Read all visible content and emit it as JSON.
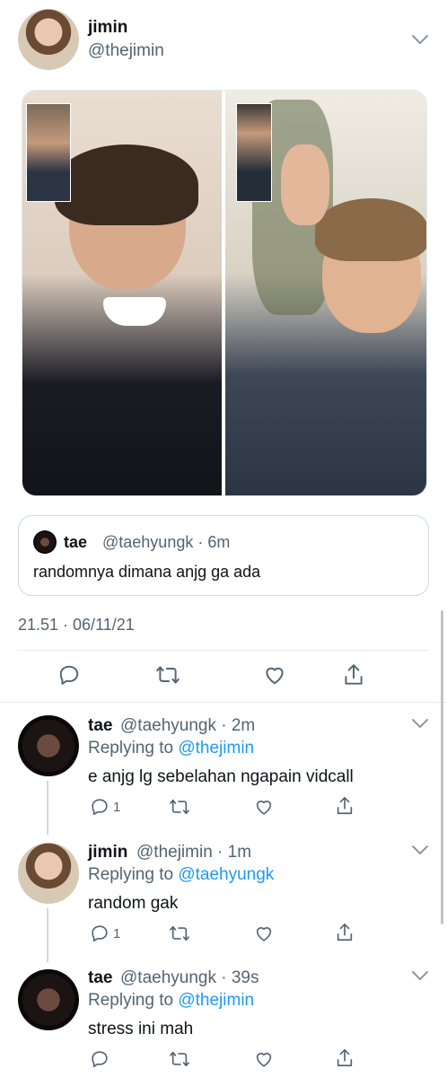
{
  "main_tweet": {
    "author_name": "jimin",
    "author_handle": "@thejimin",
    "quoted_tweet": {
      "author_name": "tae",
      "author_handle": "@taehyungk",
      "age": "6m",
      "text": "randomnya dimana anjg ga ada"
    },
    "timestamp": "21.51 · 06/11/21"
  },
  "replies": [
    {
      "author_name": "tae",
      "author_handle": "@taehyungk",
      "age": "2m",
      "replying_prefix": "Replying to ",
      "replying_to": "@thejimin",
      "text": "e anjg lg sebelahan ngapain vidcall",
      "reply_count": "1"
    },
    {
      "author_name": "jimin",
      "author_handle": "@thejimin",
      "age": "1m",
      "replying_prefix": "Replying to ",
      "replying_to": "@taehyungk",
      "text": "random gak",
      "reply_count": "1"
    },
    {
      "author_name": "tae",
      "author_handle": "@taehyungk",
      "age": "39s",
      "replying_prefix": "Replying to ",
      "replying_to": "@thejimin",
      "text": "stress ini mah",
      "reply_count": ""
    }
  ],
  "theme": {
    "accent": "#1d9bf0",
    "secondary_text": "#536471",
    "divider": "#e6ecf0"
  },
  "icons": [
    "chevron-down-icon",
    "reply-icon",
    "retweet-icon",
    "like-icon",
    "share-icon"
  ]
}
